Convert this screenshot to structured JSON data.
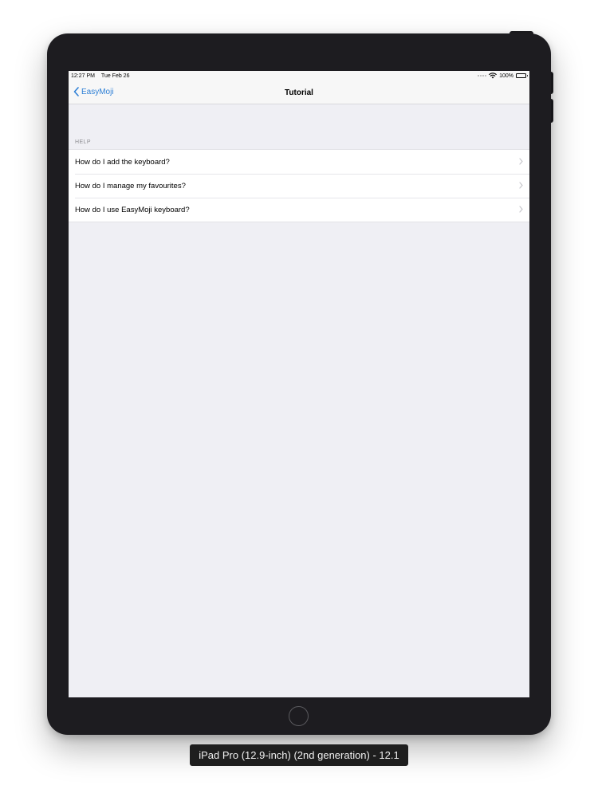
{
  "status_bar": {
    "time": "12:27 PM",
    "date": "Tue Feb 26",
    "battery": "100%"
  },
  "nav": {
    "back_label": "EasyMoji",
    "title": "Tutorial"
  },
  "help": {
    "section_title": "HELP",
    "items": [
      {
        "label": "How do I add the keyboard?"
      },
      {
        "label": "How do I manage my favourites?"
      },
      {
        "label": "How do I use EasyMoji keyboard?"
      }
    ]
  },
  "simulator": {
    "device_label": "iPad Pro (12.9-inch) (2nd generation) - 12.1"
  },
  "colors": {
    "accent": "#2f80d6",
    "background": "#efeff4",
    "bezel": "#1d1c20"
  },
  "icons": {
    "back": "chevron-left-icon",
    "row": "chevron-right-icon",
    "wifi": "wifi-icon",
    "battery": "battery-icon"
  }
}
